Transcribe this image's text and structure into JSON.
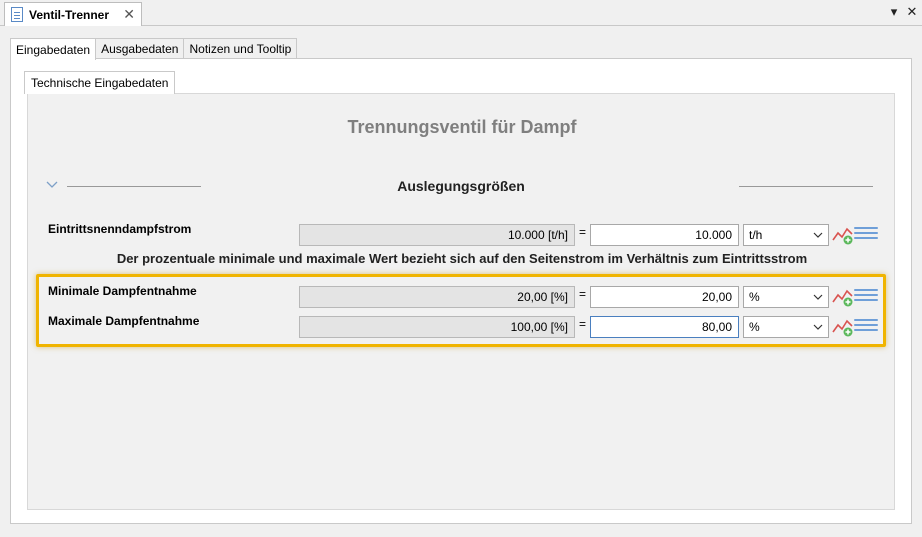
{
  "editor": {
    "tab_title": "Ventil-Trenner",
    "close_glyph": "✕",
    "menu_glyph": "▾",
    "window_close_glyph": "✕"
  },
  "tabs": [
    "Eingabedaten",
    "Ausgabedaten",
    "Notizen und Tooltip"
  ],
  "subtab": "Technische Eingabedaten",
  "form": {
    "title": "Trennungsventil für Dampf",
    "section_title": "Auslegungsgrößen",
    "info_text": "Der prozentuale minimale und maximale Wert bezieht sich auf den Seitenstrom im Verhältnis zum Eintrittsstrom",
    "rows": [
      {
        "label": "Eintrittsnenndampfstrom",
        "computed": "10.000 [t/h]",
        "equals": "=",
        "value": "10.000",
        "unit": "t/h"
      },
      {
        "label": "Minimale Dampfentnahme",
        "computed": "20,00 [%]",
        "equals": "=",
        "value": "20,00",
        "unit": "%"
      },
      {
        "label": "Maximale Dampfentnahme",
        "computed": "100,00 [%]",
        "equals": "=",
        "value": "80,00",
        "unit": "%"
      }
    ]
  },
  "colors": {
    "highlight": "#f0b400",
    "title_gray": "#7f7f7f",
    "chart_red": "#d9534f",
    "plus_green": "#5cb85c",
    "list_blue": "#6f9fd8"
  }
}
